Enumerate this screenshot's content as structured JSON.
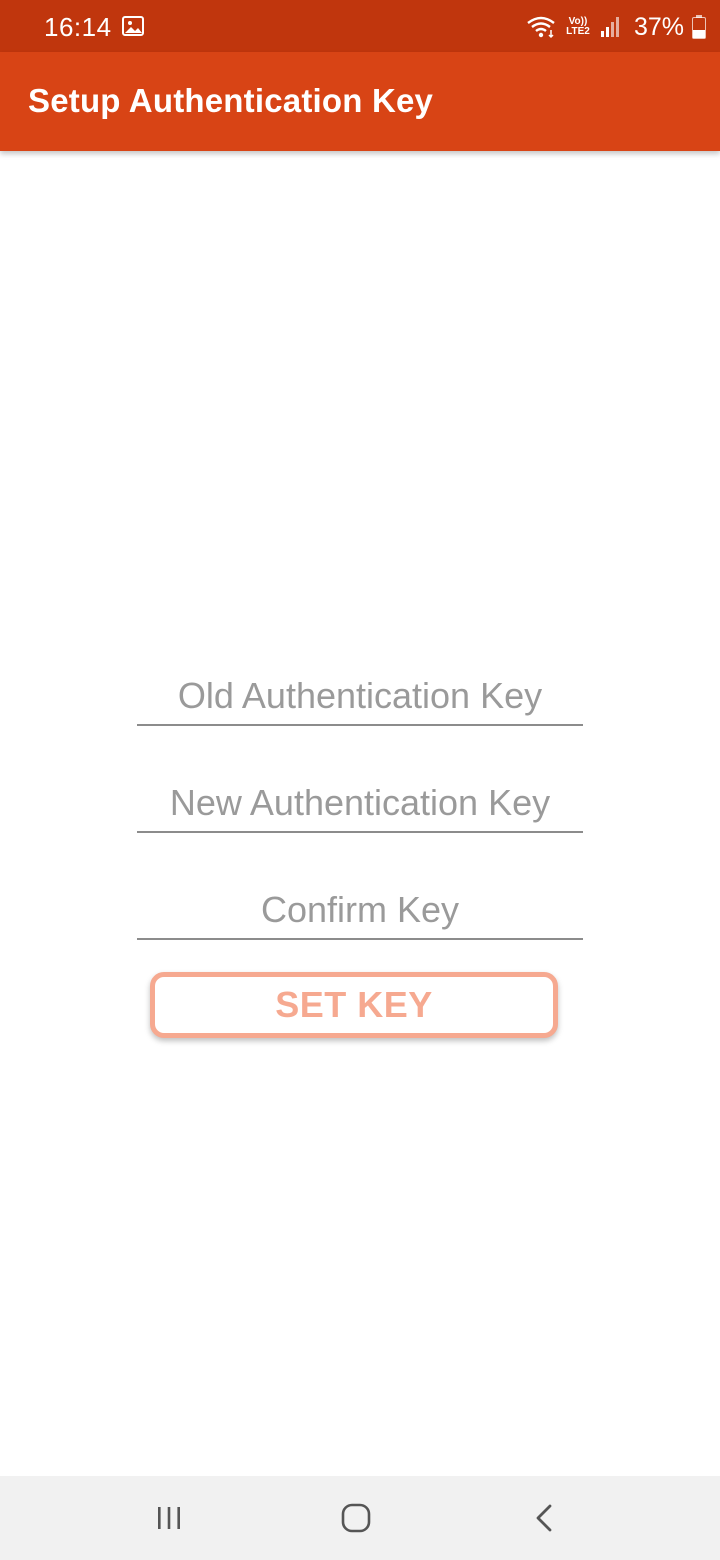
{
  "status_bar": {
    "time": "16:14",
    "network_label_top": "Vo))",
    "network_label_bottom": "LTE2",
    "battery_percent": "37%",
    "icons": [
      "gallery-icon",
      "wifi-icon",
      "volte-icon",
      "signal-icon",
      "battery-icon"
    ]
  },
  "app_bar": {
    "title": "Setup Authentication Key"
  },
  "form": {
    "old_key_placeholder": "Old Authentication Key",
    "old_key_value": "",
    "new_key_placeholder": "New Authentication Key",
    "new_key_value": "",
    "confirm_key_placeholder": "Confirm Key",
    "confirm_key_value": "",
    "submit_label": "SET KEY"
  },
  "nav_bar": {
    "icons": [
      "recents-icon",
      "home-icon",
      "back-icon"
    ]
  },
  "colors": {
    "status_bar": "#c0360d",
    "app_bar": "#d84415",
    "button_accent": "#f6a990",
    "placeholder": "#9a9a9a",
    "underline": "#8c8c8c",
    "nav_bar": "#f1f1f1"
  }
}
